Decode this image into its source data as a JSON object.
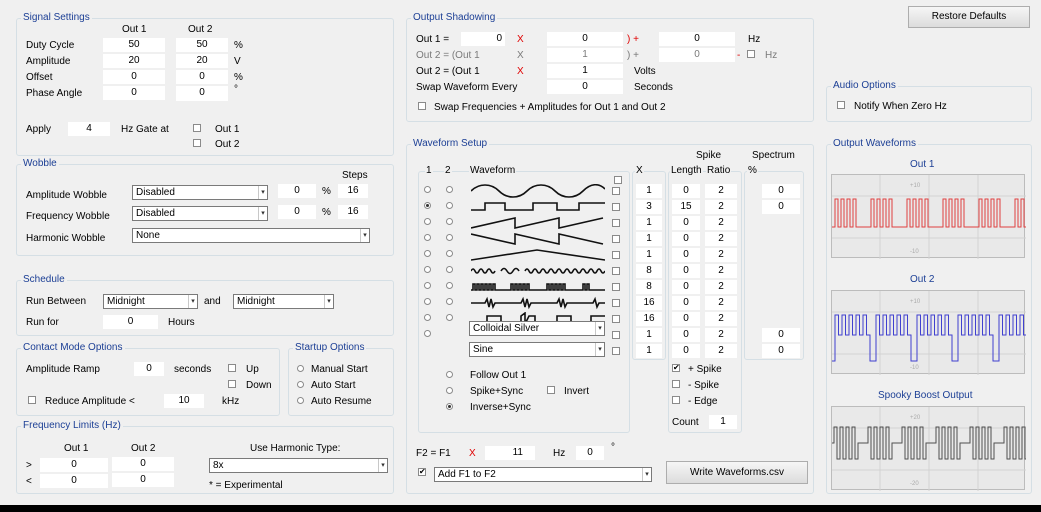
{
  "restore_defaults": "Restore Defaults",
  "signal": {
    "title": "Signal Settings",
    "out1": "Out 1",
    "out2": "Out 2",
    "rows": [
      {
        "label": "Duty Cycle",
        "v1": "50",
        "v2": "50",
        "unit": "%"
      },
      {
        "label": "Amplitude",
        "v1": "20",
        "v2": "20",
        "unit": "V"
      },
      {
        "label": "Offset",
        "v1": "0",
        "v2": "0",
        "unit": "%"
      },
      {
        "label": "Phase Angle",
        "v1": "0",
        "v2": "0",
        "unit": "°"
      }
    ],
    "apply": "Apply",
    "apply_value": "4",
    "hz_gate": "Hz Gate at",
    "gate1": "Out 1",
    "gate2": "Out 2"
  },
  "wobble": {
    "title": "Wobble",
    "steps": "Steps",
    "rows": [
      {
        "label": "Amplitude Wobble",
        "select": "Disabled",
        "value": "0",
        "unit": "%",
        "steps": "16"
      },
      {
        "label": "Frequency Wobble",
        "select": "Disabled",
        "value": "0",
        "unit": "%",
        "steps": "16"
      }
    ],
    "harmonic_label": "Harmonic Wobble",
    "harmonic_select": "None"
  },
  "schedule": {
    "title": "Schedule",
    "run_between": "Run Between",
    "from": "Midnight",
    "and": "and",
    "to": "Midnight",
    "run_for": "Run for",
    "hours_value": "0",
    "hours": "Hours"
  },
  "contact": {
    "title": "Contact Mode Options",
    "amp_ramp": "Amplitude Ramp",
    "ramp_value": "0",
    "seconds": "seconds",
    "up": "Up",
    "down": "Down",
    "reduce": "Reduce Amplitude <",
    "reduce_value": "10",
    "khz": "kHz"
  },
  "startup": {
    "title": "Startup Options",
    "options": [
      "Manual Start",
      "Auto Start",
      "Auto Resume"
    ]
  },
  "freq": {
    "title": "Frequency Limits (Hz)",
    "out1": "Out 1",
    "out2": "Out 2",
    "gt": ">",
    "lt": "<",
    "gt1": "0",
    "gt2": "0",
    "lt1": "0",
    "lt2": "0",
    "harmonic_label": "Use Harmonic Type:",
    "harmonic_value": "8x",
    "experimental": "* = Experimental"
  },
  "shadow": {
    "title": "Output Shadowing",
    "out1_eq": "Out 1 =",
    "o1_a": "0",
    "x": "X",
    "o1_b": "0",
    "paren_plus": ") +",
    "o1_c": "0",
    "hz": "Hz",
    "out2_a": "Out 2 = (Out 1",
    "o2a_b": "1",
    "o2a_c": "0",
    "dash": "-",
    "out2_b": "Out 2 = (Out 1",
    "o2b_b": "1",
    "volts": "Volts",
    "swap": "Swap Waveform Every",
    "swap_value": "0",
    "seconds": "Seconds",
    "swap_freq": "Swap Frequencies + Amplitudes for Out 1 and Out 2"
  },
  "waveform": {
    "title": "Waveform Setup",
    "col1": "1",
    "col2": "2",
    "col_wave": "Waveform",
    "col_x": "X",
    "spike": "Spike",
    "col_len": "Length",
    "col_ratio": "Ratio",
    "spectrum": "Spectrum",
    "col_pct": "%",
    "rows": [
      {
        "x": "1",
        "len": "0",
        "ratio": "2",
        "spec": "0"
      },
      {
        "x": "3",
        "len": "15",
        "ratio": "2",
        "spec": "0"
      },
      {
        "x": "1",
        "len": "0",
        "ratio": "2",
        "spec": ""
      },
      {
        "x": "1",
        "len": "0",
        "ratio": "2",
        "spec": ""
      },
      {
        "x": "1",
        "len": "0",
        "ratio": "2",
        "spec": ""
      },
      {
        "x": "8",
        "len": "0",
        "ratio": "2",
        "spec": ""
      },
      {
        "x": "8",
        "len": "0",
        "ratio": "2",
        "spec": ""
      },
      {
        "x": "16",
        "len": "0",
        "ratio": "2",
        "spec": ""
      },
      {
        "x": "16",
        "len": "0",
        "ratio": "2",
        "spec": ""
      },
      {
        "x": "1",
        "len": "0",
        "ratio": "2",
        "spec": "0"
      },
      {
        "x": "1",
        "len": "0",
        "ratio": "2",
        "spec": "0"
      }
    ],
    "preset1": "Colloidal Silver",
    "preset2": "Sine",
    "follow": "Follow Out 1",
    "spike_sync": "Spike+Sync",
    "invert": "Invert",
    "inverse_sync": "Inverse+Sync",
    "plus_spike": "+ Spike",
    "minus_spike": "- Spike",
    "minus_edge": "- Edge",
    "count": "Count",
    "count_value": "1",
    "f2": "F2 = F1",
    "f2_x": "X",
    "f2_value": "11",
    "f2_hz": "Hz",
    "f2_phase": "0",
    "deg": "°",
    "add": "Add F1 to F2",
    "write": "Write Waveforms.csv"
  },
  "audio": {
    "title": "Audio Options",
    "notify": "Notify When Zero Hz"
  },
  "outputs": {
    "title": "Output Waveforms",
    "out1": "Out 1",
    "out2": "Out 2",
    "boost": "Spooky Boost Output",
    "scope1_ticks": [
      "+10",
      "-10"
    ],
    "scope2_ticks": [
      "+10",
      "-10"
    ],
    "scope3_ticks": [
      "+20",
      "-20"
    ],
    "colors": {
      "out1": "#e04040",
      "out2": "#4040d0",
      "boost": "#505050"
    }
  }
}
